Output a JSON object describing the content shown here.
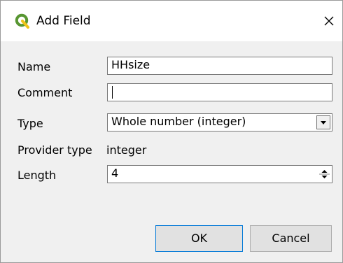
{
  "window": {
    "title": "Add Field"
  },
  "form": {
    "name_label": "Name",
    "name_value": "HHsize",
    "comment_label": "Comment",
    "comment_value": "",
    "type_label": "Type",
    "type_value": "Whole number (integer)",
    "provider_type_label": "Provider type",
    "provider_type_value": "integer",
    "length_label": "Length",
    "length_value": "4"
  },
  "buttons": {
    "ok_label": "OK",
    "cancel_label": "Cancel"
  },
  "colors": {
    "qgis_green": "#589632",
    "qgis_yellow": "#ee7913",
    "default_button_border": "#0078d7"
  }
}
